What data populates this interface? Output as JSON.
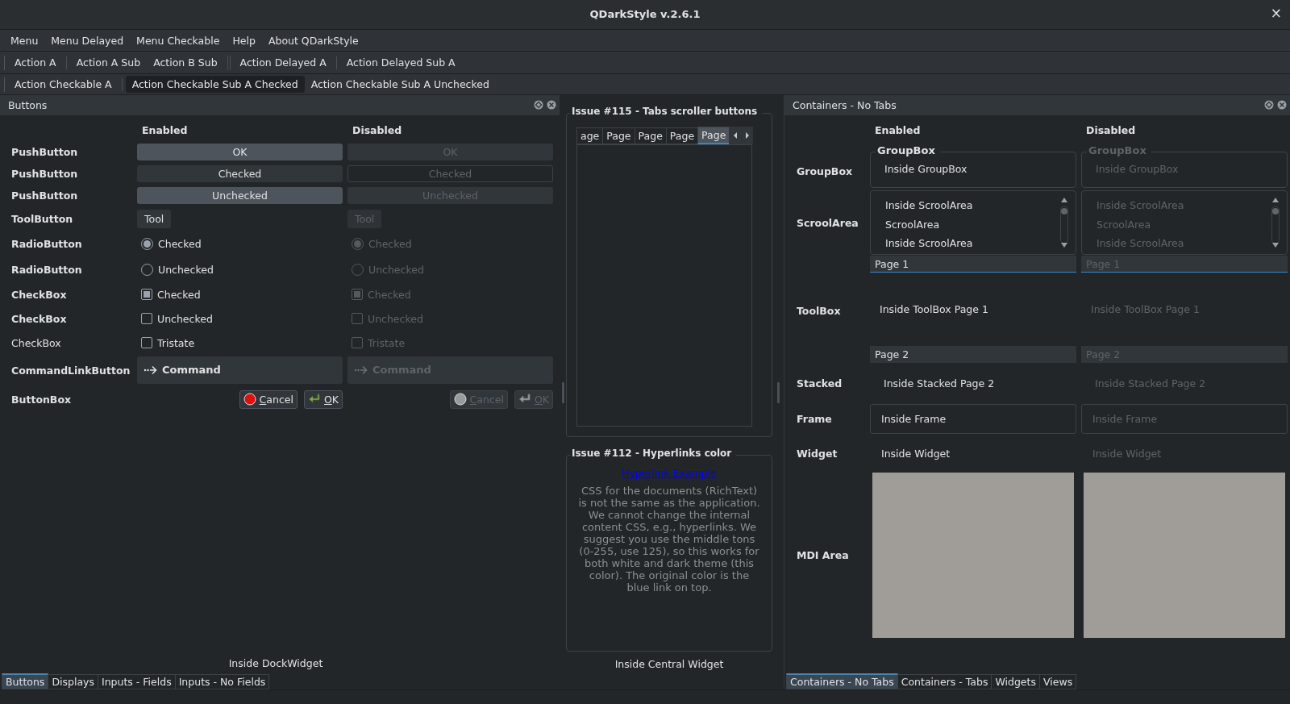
{
  "window": {
    "title": "QDarkStyle v.2.6.1",
    "close": "×"
  },
  "menu": [
    "Menu",
    "Menu Delayed",
    "Menu Checkable",
    "Help",
    "About QDarkStyle"
  ],
  "toolbars": [
    {
      "groups": [
        {
          "kind": "first",
          "actions": [
            {
              "label": "Action A",
              "checked": false
            }
          ]
        },
        {
          "kind": "separated",
          "actions": [
            {
              "label": "Action A Sub",
              "checked": false
            },
            {
              "label": "Action B Sub",
              "checked": false
            }
          ]
        },
        {
          "kind": "double-separated",
          "actions": [
            {
              "label": "Action Delayed A",
              "checked": false
            }
          ]
        },
        {
          "kind": "separated",
          "actions": [
            {
              "label": "Action Delayed Sub A",
              "checked": false
            }
          ]
        }
      ]
    },
    {
      "groups": [
        {
          "kind": "first",
          "actions": [
            {
              "label": "Action Checkable A",
              "checked": false
            }
          ]
        },
        {
          "kind": "separated",
          "actions": [
            {
              "label": "Action Checkable Sub A Checked",
              "checked": true
            },
            {
              "label": "Action Checkable Sub A Unchecked",
              "checked": false
            }
          ]
        }
      ]
    }
  ],
  "left_dock": {
    "title": "Buttons",
    "columns": [
      "Enabled",
      "Disabled"
    ],
    "rows": [
      {
        "kind": "push",
        "label": "PushButton",
        "bold": true,
        "cells": [
          {
            "text": "OK",
            "checked": false,
            "disabled": false
          },
          {
            "text": "OK",
            "checked": false,
            "disabled": true
          }
        ]
      },
      {
        "kind": "push",
        "label": "PushButton",
        "bold": true,
        "cells": [
          {
            "text": "Checked",
            "checked": true,
            "disabled": false
          },
          {
            "text": "Checked",
            "checked": true,
            "disabled": true
          }
        ]
      },
      {
        "kind": "push",
        "label": "PushButton",
        "bold": true,
        "cells": [
          {
            "text": "Unchecked",
            "checked": false,
            "disabled": false
          },
          {
            "text": "Unchecked",
            "checked": false,
            "disabled": true
          }
        ]
      },
      {
        "kind": "tool",
        "label": "ToolButton",
        "bold": true,
        "cells": [
          {
            "text": "Tool",
            "disabled": false
          },
          {
            "text": "Tool",
            "disabled": true
          }
        ]
      },
      {
        "kind": "radio",
        "label": "RadioButton",
        "bold": true,
        "cells": [
          {
            "text": "Checked",
            "checked": true,
            "disabled": false
          },
          {
            "text": "Checked",
            "checked": true,
            "disabled": true
          }
        ]
      },
      {
        "kind": "radio",
        "label": "RadioButton",
        "bold": true,
        "cells": [
          {
            "text": "Unchecked",
            "checked": false,
            "disabled": false
          },
          {
            "text": "Unchecked",
            "checked": false,
            "disabled": true
          }
        ]
      },
      {
        "kind": "checkbox",
        "label": "CheckBox",
        "bold": true,
        "cells": [
          {
            "text": "Checked",
            "checked": true,
            "disabled": false
          },
          {
            "text": "Checked",
            "checked": true,
            "disabled": true
          }
        ]
      },
      {
        "kind": "checkbox",
        "label": "CheckBox",
        "bold": true,
        "cells": [
          {
            "text": "Unchecked",
            "checked": false,
            "disabled": false
          },
          {
            "text": "Unchecked",
            "checked": false,
            "disabled": true
          }
        ]
      },
      {
        "kind": "checkbox",
        "label": "CheckBox",
        "bold": false,
        "cells": [
          {
            "text": "Tristate",
            "checked": false,
            "disabled": false
          },
          {
            "text": "Tristate",
            "checked": false,
            "disabled": true
          }
        ]
      },
      {
        "kind": "command",
        "label": "CommandLinkButton",
        "bold": true,
        "cells": [
          {
            "text": "Command",
            "disabled": false
          },
          {
            "text": "Command",
            "disabled": true
          }
        ]
      },
      {
        "kind": "buttonbox",
        "label": "ButtonBox",
        "bold": true,
        "cells": [
          {
            "buttons": [
              {
                "kind": "cancel",
                "text": "Cancel"
              },
              {
                "kind": "ok",
                "text": "OK"
              }
            ],
            "disabled": false
          },
          {
            "buttons": [
              {
                "kind": "cancel",
                "text": "Cancel"
              },
              {
                "kind": "ok",
                "text": "OK"
              }
            ],
            "disabled": true
          }
        ]
      }
    ],
    "footer": "Inside DockWidget",
    "tabs": [
      {
        "label": "Buttons",
        "selected": true
      },
      {
        "label": "Displays",
        "selected": false
      },
      {
        "label": "Inputs - Fields",
        "selected": false
      },
      {
        "label": "Inputs - No Fields",
        "selected": false
      }
    ]
  },
  "central": {
    "groups": [
      {
        "kind": "tabs",
        "title": "Issue #115 - Tabs scroller buttons",
        "tabs": [
          {
            "label": "age",
            "selected": false
          },
          {
            "label": "Page",
            "selected": false
          },
          {
            "label": "Page",
            "selected": false
          },
          {
            "label": "Page",
            "selected": false
          },
          {
            "label": "Page",
            "selected": true
          }
        ]
      },
      {
        "kind": "links",
        "title": "Issue #112 - Hyperlinks color",
        "link": "Hyperlink Example",
        "text": "CSS for the documents (RichText) is not the same as the application. We cannot change the internal content CSS, e.g., hyperlinks. We suggest you use the middle tons (0-255, use 125), so this works for both white and dark theme (this color). The original color is the blue link on top."
      }
    ],
    "footer": "Inside Central Widget"
  },
  "right_dock": {
    "title": "Containers - No Tabs",
    "columns": [
      "Enabled",
      "Disabled"
    ],
    "rows": [
      {
        "kind": "groupbox",
        "label": "GroupBox",
        "cells": [
          {
            "title": "GroupBox",
            "text": "Inside GroupBox",
            "disabled": false
          },
          {
            "title": "GroupBox",
            "text": "Inside GroupBox",
            "disabled": true
          }
        ]
      },
      {
        "kind": "scrollarea",
        "label": "ScroolArea",
        "cells": [
          {
            "items": [
              "Inside ScroolArea",
              "ScroolArea",
              "Inside ScroolArea"
            ],
            "disabled": false
          },
          {
            "items": [
              "Inside ScroolArea",
              "ScroolArea",
              "Inside ScroolArea"
            ],
            "disabled": true
          }
        ]
      },
      {
        "kind": "toolbox",
        "label": "ToolBox",
        "cells": [
          {
            "pages": [
              {
                "title": "Page 1",
                "expanded": true,
                "text": "Inside ToolBox Page 1"
              },
              {
                "title": "Page 2",
                "expanded": false
              }
            ],
            "disabled": false
          },
          {
            "pages": [
              {
                "title": "Page 1",
                "expanded": true,
                "text": "Inside ToolBox Page 1"
              },
              {
                "title": "Page 2",
                "expanded": false
              }
            ],
            "disabled": true
          }
        ]
      },
      {
        "kind": "stacked",
        "label": "Stacked",
        "cells": [
          {
            "text": "Inside Stacked Page 2",
            "disabled": false
          },
          {
            "text": "Inside Stacked Page 2",
            "disabled": true
          }
        ]
      },
      {
        "kind": "frame",
        "label": "Frame",
        "cells": [
          {
            "text": "Inside Frame",
            "disabled": false
          },
          {
            "text": "Inside Frame",
            "disabled": true
          }
        ]
      },
      {
        "kind": "widget",
        "label": "Widget",
        "cells": [
          {
            "text": "Inside Widget",
            "disabled": false
          },
          {
            "text": "Inside Widget",
            "disabled": true
          }
        ]
      },
      {
        "kind": "mdi",
        "label": "MDI Area",
        "cells": [
          {
            "kind": "mdi-area"
          },
          {
            "kind": "mdi-area"
          }
        ]
      }
    ],
    "tabs": [
      {
        "label": "Containers - No Tabs",
        "selected": true
      },
      {
        "label": "Containers - Tabs",
        "selected": false
      },
      {
        "label": "Widgets",
        "selected": false
      },
      {
        "label": "Views",
        "selected": false
      }
    ]
  }
}
